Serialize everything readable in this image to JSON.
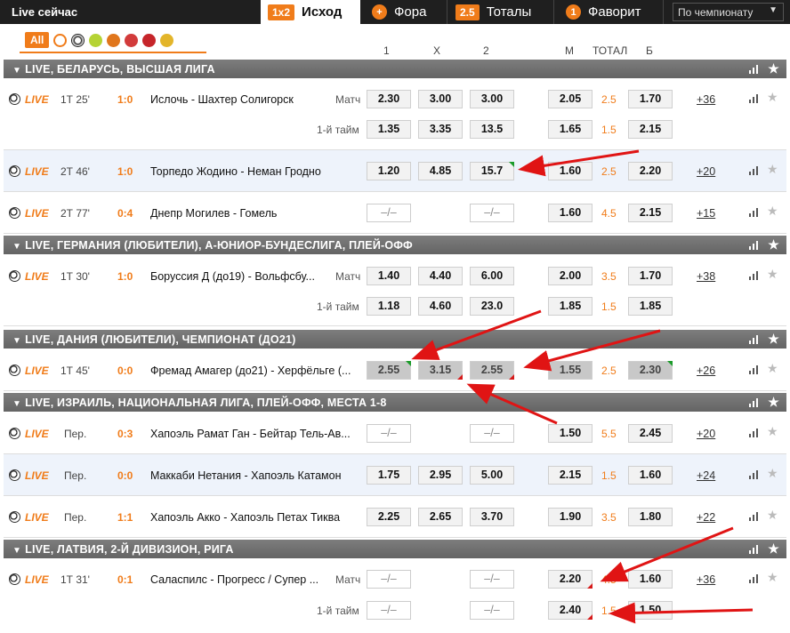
{
  "topbar": {
    "live_now": "Live сейчас",
    "tabs": [
      {
        "badge": "1x2",
        "label": "Исход"
      },
      {
        "badge": "+",
        "label": "Фора"
      },
      {
        "badge": "2.5",
        "label": "Тоталы"
      },
      {
        "badge": "1",
        "label": "Фаворит"
      }
    ],
    "select": "По чемпионату"
  },
  "filters": {
    "all": "All"
  },
  "columns": {
    "c1": "1",
    "cx": "X",
    "c2": "2",
    "m": "М",
    "total": "ТОТАЛ",
    "b": "Б"
  },
  "sections": [
    {
      "title": "LIVE, БЕЛАРУСЬ, ВЫСШАЯ ЛИГА"
    },
    {
      "title": "LIVE, ГЕРМАНИЯ (ЛЮБИТЕЛИ), А-ЮНИОР-БУНДЕСЛИГА, ПЛЕЙ-ОФФ"
    },
    {
      "title": "LIVE, ДАНИЯ (ЛЮБИТЕЛИ), ЧЕМПИОНАТ (ДО21)"
    },
    {
      "title": "LIVE, ИЗРАИЛЬ, НАЦИОНАЛЬНАЯ ЛИГА, ПЛЕЙ-ОФФ, МЕСТА 1-8"
    },
    {
      "title": "LIVE, ЛАТВИЯ, 2-Й ДИВИЗИОН, РИГА"
    }
  ],
  "live_label": "LIVE",
  "match_label": "Матч",
  "half_label": "1-й тайм",
  "dash": "–/–",
  "matches": [
    {
      "time": "1Т 25'",
      "score": "1:0",
      "teams": "Ислочь - Шахтер Солигорск",
      "o1": "2.30",
      "ox": "3.00",
      "o2": "3.00",
      "m": "2.05",
      "t": "2.5",
      "b": "1.70",
      "more": "+36",
      "h1": "1.35",
      "hx": "3.35",
      "h2": "13.5",
      "hm": "1.65",
      "ht": "1.5",
      "hb": "2.15"
    },
    {
      "time": "2Т 46'",
      "score": "1:0",
      "teams": "Торпедо Жодино - Неман Гродно",
      "o1": "1.20",
      "ox": "4.85",
      "o2": "15.7",
      "m": "1.60",
      "t": "2.5",
      "b": "2.20",
      "more": "+20"
    },
    {
      "time": "2Т 77'",
      "score": "0:4",
      "teams": "Днепр Могилев - Гомель",
      "m": "1.60",
      "t": "4.5",
      "b": "2.15",
      "more": "+15"
    },
    {
      "time": "1Т 30'",
      "score": "1:0",
      "teams": "Боруссия Д (до19) - Вольфсбу...",
      "o1": "1.40",
      "ox": "4.40",
      "o2": "6.00",
      "m": "2.00",
      "t": "3.5",
      "b": "1.70",
      "more": "+38",
      "h1": "1.18",
      "hx": "4.60",
      "h2": "23.0",
      "hm": "1.85",
      "ht": "1.5",
      "hb": "1.85"
    },
    {
      "time": "1Т 45'",
      "score": "0:0",
      "teams": "Фремад Амагер (до21) - Херфёльге (...",
      "o1": "2.55",
      "ox": "3.15",
      "o2": "2.55",
      "m": "1.55",
      "t": "2.5",
      "b": "2.30",
      "more": "+26"
    },
    {
      "time": "Пер.",
      "score": "0:3",
      "teams": "Хапоэль Рамат Ган - Бейтар Тель-Ав...",
      "m": "1.50",
      "t": "5.5",
      "b": "2.45",
      "more": "+20"
    },
    {
      "time": "Пер.",
      "score": "0:0",
      "teams": "Маккаби Нетания - Хапоэль Катамон",
      "o1": "1.75",
      "ox": "2.95",
      "o2": "5.00",
      "m": "2.15",
      "t": "1.5",
      "b": "1.60",
      "more": "+24"
    },
    {
      "time": "Пер.",
      "score": "1:1",
      "teams": "Хапоэль Акко - Хапоэль Петах Тиква",
      "o1": "2.25",
      "ox": "2.65",
      "o2": "3.70",
      "m": "1.90",
      "t": "3.5",
      "b": "1.80",
      "more": "+22"
    },
    {
      "time": "1Т 31'",
      "score": "0:1",
      "teams": "Саласпилс - Прогресс / Супер ...",
      "m": "2.20",
      "t": "4.5",
      "b": "1.60",
      "more": "+36",
      "hm": "2.40",
      "ht": "1.5",
      "hb": "1.50"
    }
  ],
  "colors": {
    "accent": "#f07c1a",
    "section": "#6e6e6e",
    "arrow": "#e01414"
  }
}
